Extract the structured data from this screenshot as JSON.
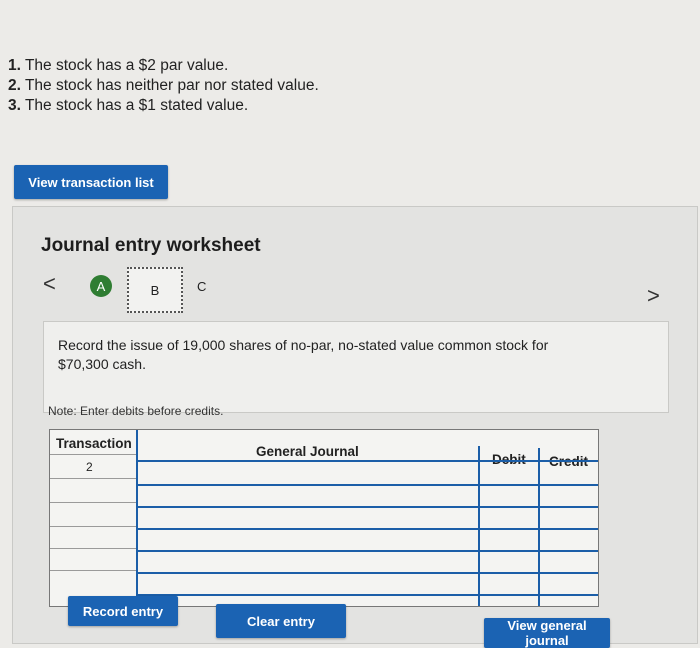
{
  "instructions": [
    {
      "num": "1.",
      "text": " The stock has a $2 par value."
    },
    {
      "num": "2.",
      "text": " The stock has neither par nor stated value."
    },
    {
      "num": "3.",
      "text": " The stock has a $1 stated value."
    }
  ],
  "buttons": {
    "view_transaction_list": "View transaction list",
    "record_entry": "Record entry",
    "clear_entry": "Clear entry",
    "view_general_journal": "View general journal"
  },
  "worksheet": {
    "title": "Journal entry worksheet",
    "nav_prev": "<",
    "nav_next": ">",
    "steps": [
      "A",
      "B",
      "C"
    ],
    "prompt": "Record the issue of 19,000 shares of no-par, no-stated value common stock for $70,300 cash.",
    "note": "Note: Enter debits before credits."
  },
  "journal": {
    "headers": {
      "transaction": "Transaction",
      "general_journal": "General Journal",
      "debit": "Debit",
      "credit": "Credit"
    },
    "rows": [
      {
        "transaction": "2",
        "account": "",
        "debit": "",
        "credit": ""
      },
      {
        "transaction": "",
        "account": "",
        "debit": "",
        "credit": ""
      },
      {
        "transaction": "",
        "account": "",
        "debit": "",
        "credit": ""
      },
      {
        "transaction": "",
        "account": "",
        "debit": "",
        "credit": ""
      },
      {
        "transaction": "",
        "account": "",
        "debit": "",
        "credit": ""
      },
      {
        "transaction": "",
        "account": "",
        "debit": "",
        "credit": ""
      }
    ]
  },
  "colors": {
    "button_blue": "#1b63b3",
    "step_done_green": "#2f7d32",
    "grid_blue": "#1b5ea8"
  }
}
